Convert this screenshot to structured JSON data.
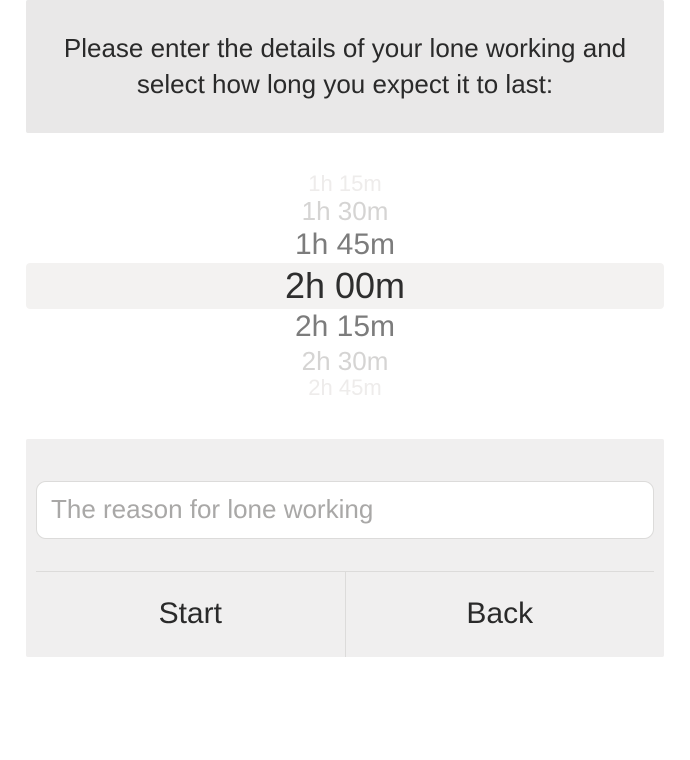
{
  "header": {
    "text": "Please enter the details of your lone working and select how long you expect it to last:"
  },
  "picker": {
    "options": [
      "1h 15m",
      "1h 30m",
      "1h 45m",
      "2h 00m",
      "2h 15m",
      "2h 30m",
      "2h 45m"
    ],
    "selected_index": 3
  },
  "reason": {
    "placeholder": "The reason for lone working",
    "value": ""
  },
  "buttons": {
    "start": "Start",
    "back": "Back"
  }
}
